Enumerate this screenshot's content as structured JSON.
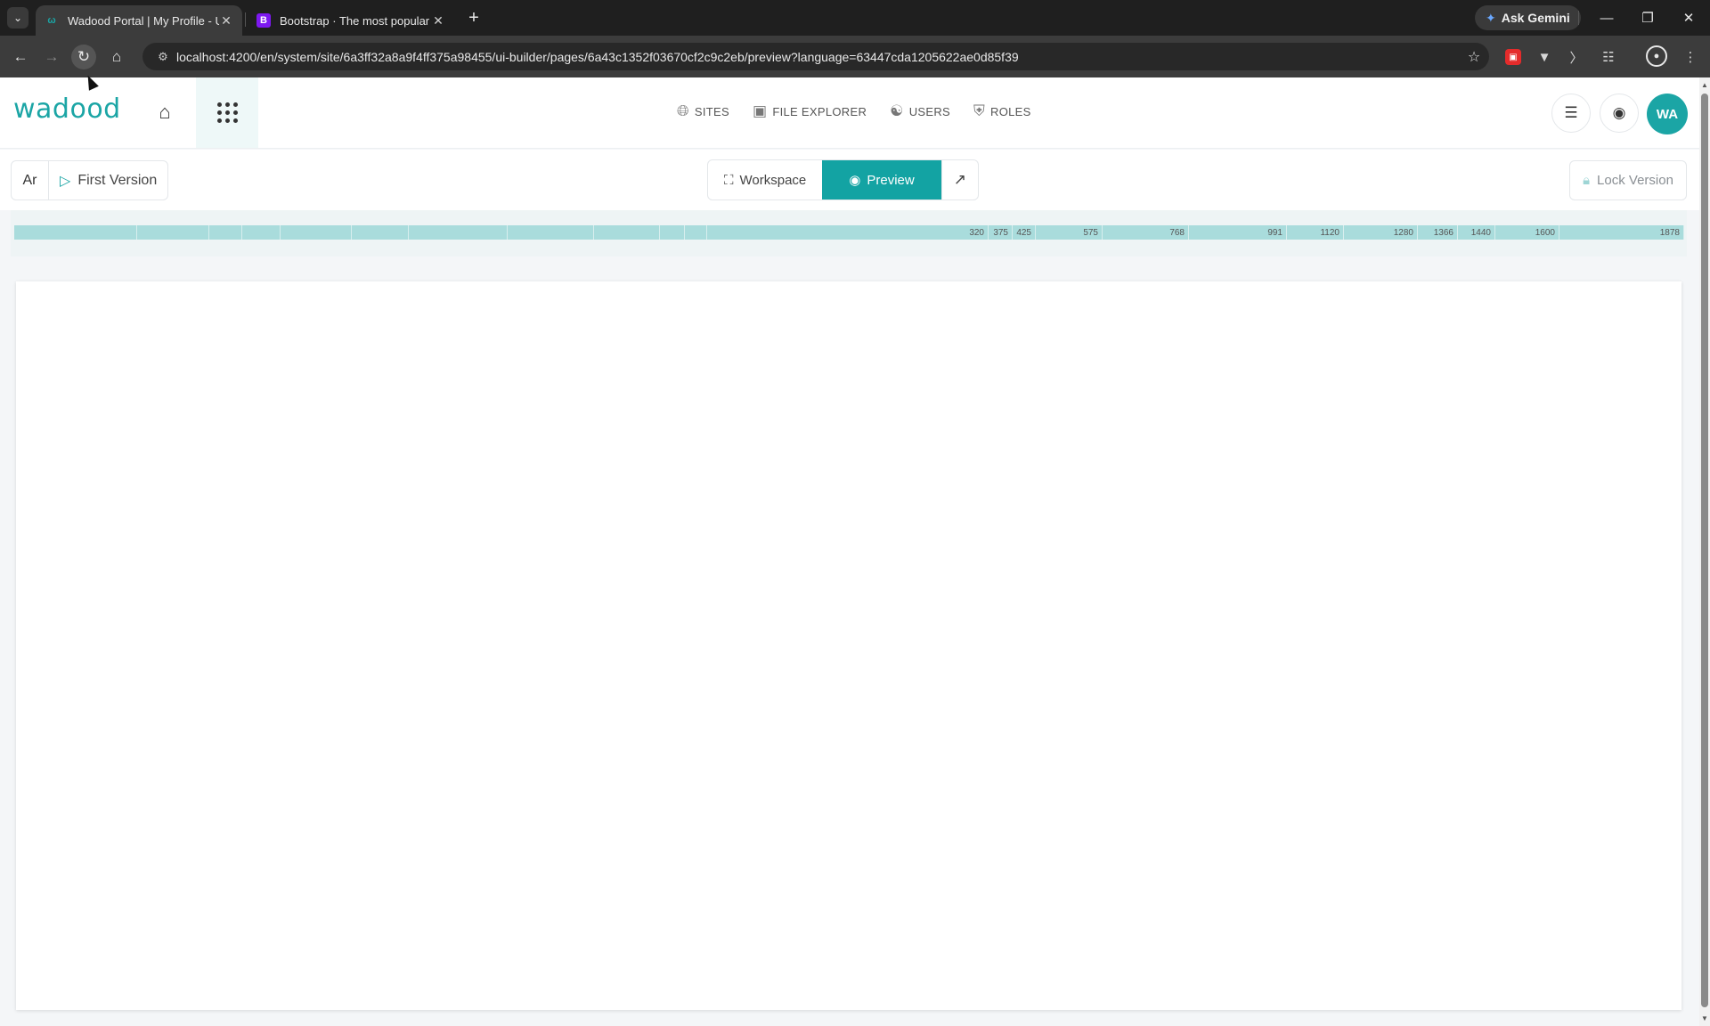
{
  "browser": {
    "tabs": [
      {
        "title": "Wadood Portal | My Profile - U",
        "favicon": "wadood-icon",
        "active": true
      },
      {
        "title": "Bootstrap · The most popular H",
        "favicon": "B",
        "active": false
      }
    ],
    "gemini_label": "Ask Gemini",
    "url": "localhost:4200/en/system/site/6a3ff32a8a9f4ff375a98455/ui-builder/pages/6a43c1352f03670cf2c9c2eb/preview?language=63447cda1205622ae0d85f39"
  },
  "header": {
    "logo_text": "wadood",
    "nav": [
      {
        "label": "SITES",
        "icon": "globe-icon"
      },
      {
        "label": "FILE EXPLORER",
        "icon": "images-icon"
      },
      {
        "label": "USERS",
        "icon": "users-icon"
      },
      {
        "label": "ROLES",
        "icon": "shield-icon"
      }
    ],
    "avatar_initials": "WA"
  },
  "builder": {
    "language_label": "Ar",
    "version_label": "First Version",
    "workspace_label": "Workspace",
    "preview_label": "Preview",
    "lock_label": "Lock Version",
    "active_mode": "Preview"
  },
  "ruler": {
    "labels": [
      "320",
      "375",
      "425",
      "575",
      "768",
      "991",
      "1120",
      "1280",
      "1366",
      "1440",
      "1600",
      "1878"
    ]
  },
  "colors": {
    "accent": "#13a3a3",
    "ruler": "#a9dcdc"
  }
}
